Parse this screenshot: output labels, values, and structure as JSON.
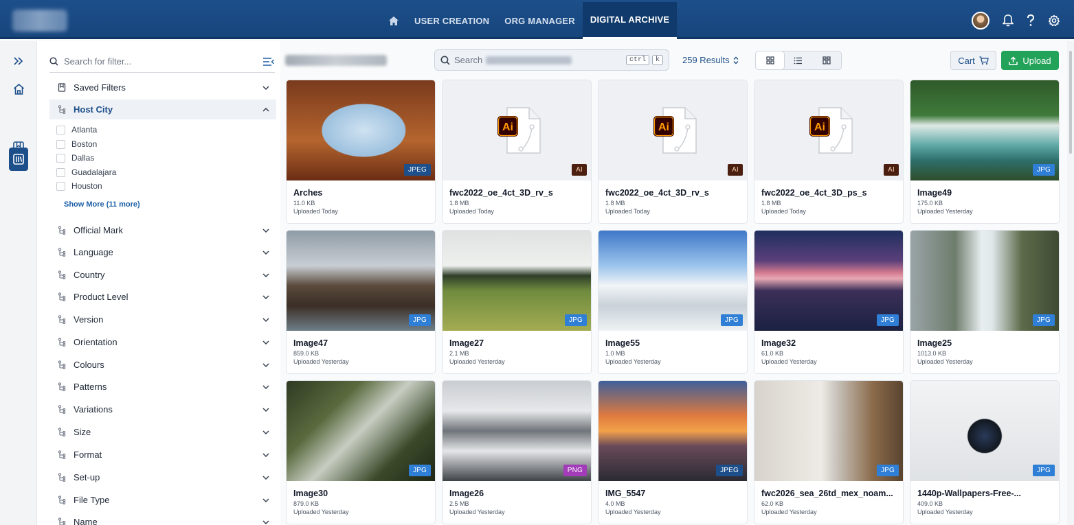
{
  "nav": {
    "items": [
      "USER CREATION",
      "ORG MANAGER",
      "DIGITAL ARCHIVE"
    ],
    "active": "DIGITAL ARCHIVE"
  },
  "filters": {
    "search_placeholder": "Search for filter...",
    "saved_filters": "Saved Filters",
    "host_city": {
      "label": "Host City",
      "options": [
        "Atlanta",
        "Boston",
        "Dallas",
        "Guadalajara",
        "Houston"
      ],
      "show_more": "Show More (11 more)"
    },
    "groups": [
      "Official Mark",
      "Language",
      "Country",
      "Product Level",
      "Version",
      "Orientation",
      "Colours",
      "Patterns",
      "Variations",
      "Size",
      "Format",
      "Set-up",
      "File Type",
      "Name"
    ]
  },
  "toolbar": {
    "search_placeholder": "Search",
    "kbd": [
      "ctrl",
      "k"
    ],
    "results": "259 Results",
    "cart": "Cart",
    "upload": "Upload"
  },
  "colors": {
    "header": "#1d4f8a",
    "upload": "#23a35a",
    "badge_jpg": "#2f7fd6",
    "badge_jpeg": "#1d4f8a",
    "badge_ai": "#4a1f10",
    "badge_png": "#a23cb8"
  },
  "files": [
    {
      "name": "Arches",
      "size": "11.0 KB",
      "uploaded": "Uploaded Today",
      "type": "JPEG"
    },
    {
      "name": "fwc2022_oe_4ct_3D_rv_s",
      "size": "1.8 MB",
      "uploaded": "Uploaded Today",
      "type": "AI"
    },
    {
      "name": "fwc2022_oe_4ct_3D_rv_s",
      "size": "1.8 MB",
      "uploaded": "Uploaded Today",
      "type": "AI"
    },
    {
      "name": "fwc2022_oe_4ct_3D_ps_s",
      "size": "1.8 MB",
      "uploaded": "Uploaded Today",
      "type": "AI"
    },
    {
      "name": "Image49",
      "size": "175.0 KB",
      "uploaded": "Uploaded Yesterday",
      "type": "JPG"
    },
    {
      "name": "Image47",
      "size": "859.0 KB",
      "uploaded": "Uploaded Yesterday",
      "type": "JPG"
    },
    {
      "name": "Image27",
      "size": "2.1 MB",
      "uploaded": "Uploaded Yesterday",
      "type": "JPG"
    },
    {
      "name": "Image55",
      "size": "1.0 MB",
      "uploaded": "Uploaded Yesterday",
      "type": "JPG"
    },
    {
      "name": "Image32",
      "size": "61.0 KB",
      "uploaded": "Uploaded Yesterday",
      "type": "JPG"
    },
    {
      "name": "Image25",
      "size": "1013.0 KB",
      "uploaded": "Uploaded Yesterday",
      "type": "JPG"
    },
    {
      "name": "Image30",
      "size": "879.0 KB",
      "uploaded": "Uploaded Yesterday",
      "type": "JPG"
    },
    {
      "name": "Image26",
      "size": "2.5 MB",
      "uploaded": "Uploaded Yesterday",
      "type": "PNG"
    },
    {
      "name": "IMG_5547",
      "size": "4.0 MB",
      "uploaded": "Uploaded Yesterday",
      "type": "JPEG"
    },
    {
      "name": "fwc2026_sea_26td_mex_noam...",
      "size": "62.0 KB",
      "uploaded": "Uploaded Yesterday",
      "type": "JPG"
    },
    {
      "name": "1440p-Wallpapers-Free-...",
      "size": "409.0 KB",
      "uploaded": "Uploaded Yesterday",
      "type": "JPG"
    }
  ]
}
